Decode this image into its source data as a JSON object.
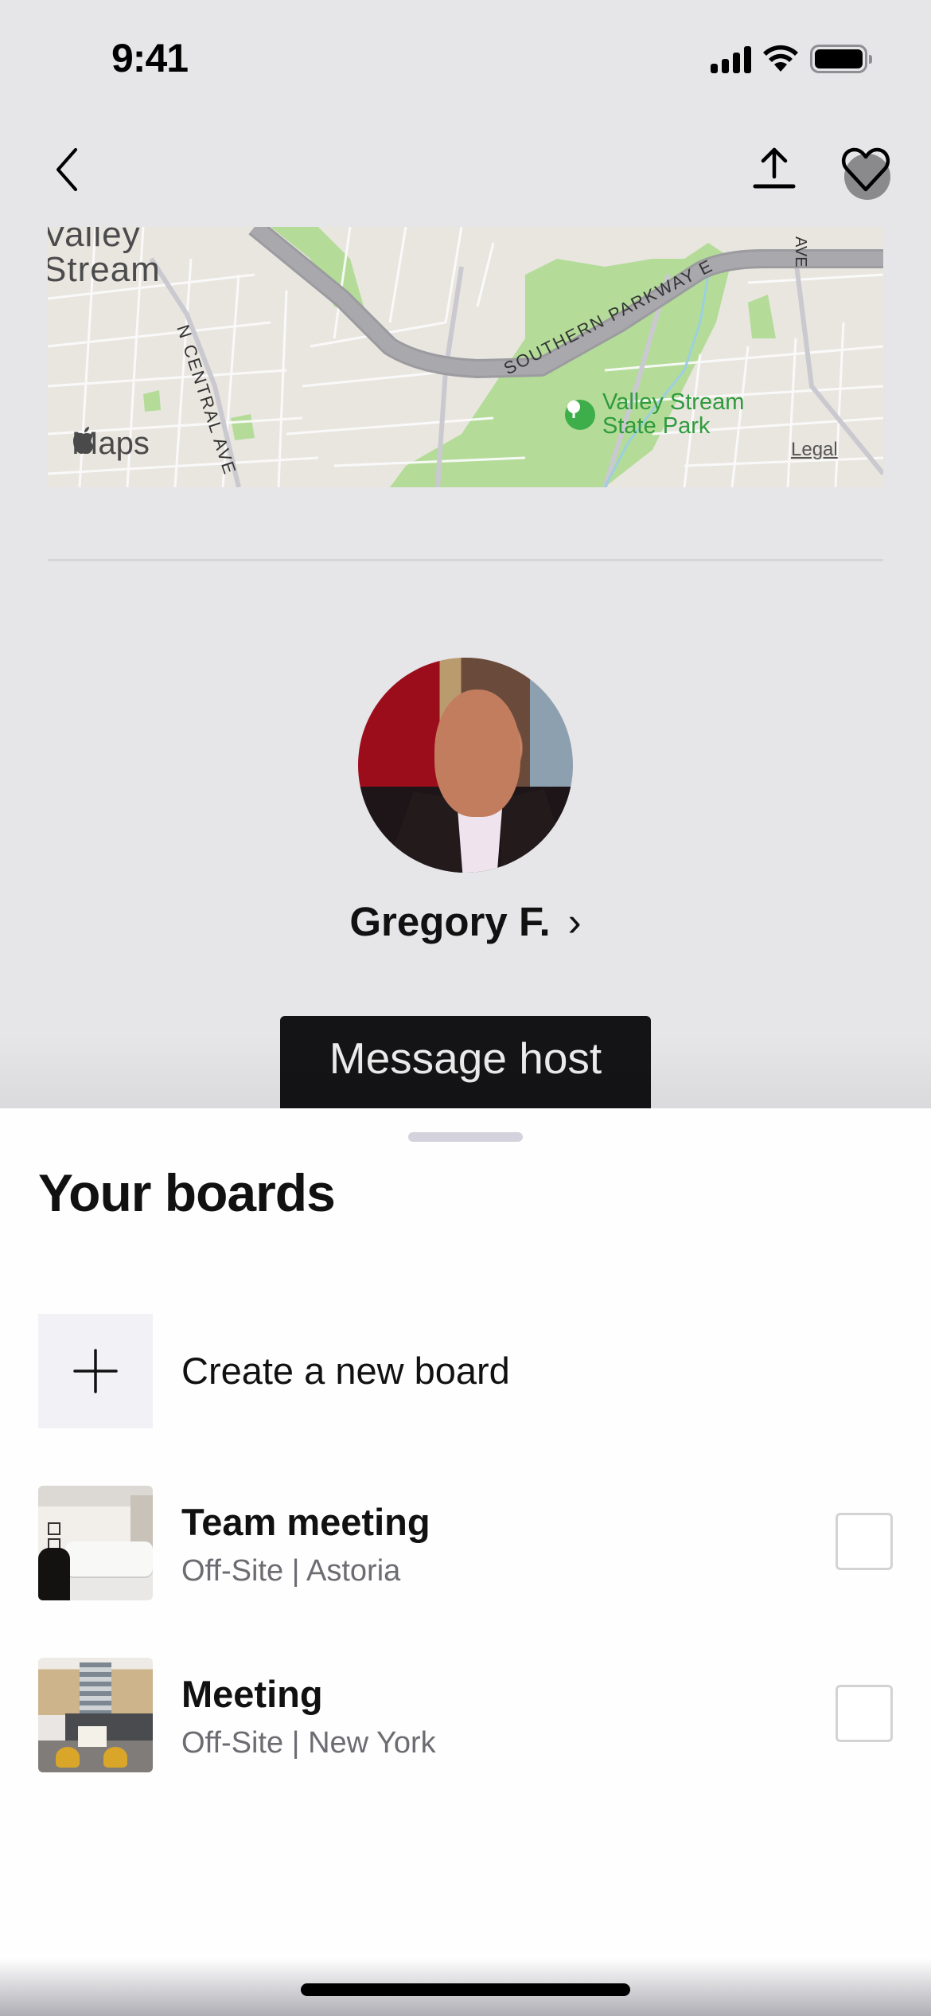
{
  "status_bar": {
    "time": "9:41",
    "icons": [
      "cellular-signal-icon",
      "wifi-icon",
      "battery-icon"
    ]
  },
  "nav": {
    "back_icon": "chevron-left-icon",
    "share_icon": "share-upload-icon",
    "favorite_icon": "heart-icon"
  },
  "map": {
    "town_label_line1": "Valley",
    "town_label_line2": "Stream",
    "road_labels": [
      "N CENTRAL AVE",
      "SOUTHERN PARKWAY E",
      "AVE"
    ],
    "park_label_line1": "Valley Stream",
    "park_label_line2": "State Park",
    "provider": "Maps",
    "legal_link": "Legal"
  },
  "host": {
    "name": "Gregory F.",
    "chevron": "›",
    "message_button": "Message host"
  },
  "sheet": {
    "title": "Your boards",
    "create_label": "Create a new board",
    "boards": [
      {
        "title": "Team meeting",
        "subtitle": "Off-Site | Astoria",
        "checked": false
      },
      {
        "title": "Meeting",
        "subtitle": "Off-Site | New York",
        "checked": false
      }
    ]
  },
  "colors": {
    "background": "#e6e5e8",
    "button_dark": "#141416",
    "park_green": "#3dae4a",
    "subtitle_gray": "#6c6c72"
  }
}
